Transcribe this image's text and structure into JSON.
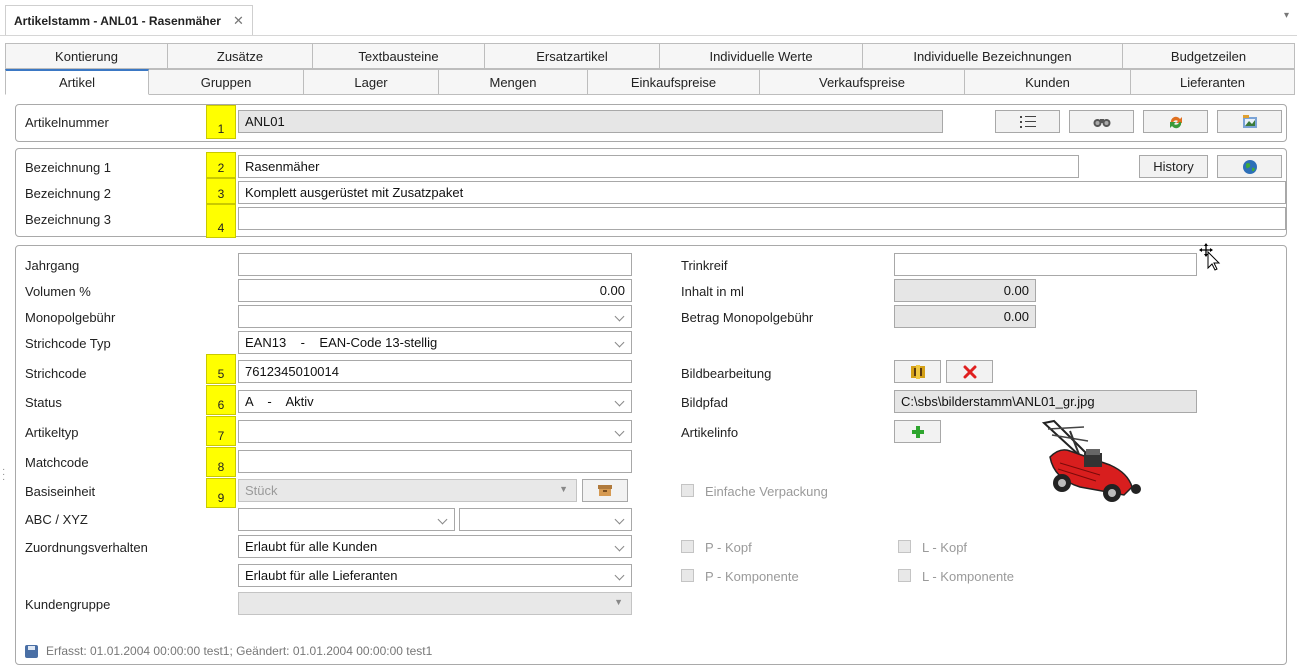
{
  "window": {
    "doc_tab_title": "Artikelstamm - ANL01 - Rasenmäher",
    "close_glyph": "✕",
    "dropdown_glyph": "▾"
  },
  "tabs_row1": [
    "Kontierung",
    "Zusätze",
    "Textbausteine",
    "Ersatzartikel",
    "Individuelle Werte",
    "Individuelle Bezeichnungen",
    "Budgetzeilen"
  ],
  "tabs_row2": [
    "Artikel",
    "Gruppen",
    "Lager",
    "Mengen",
    "Einkaufspreise",
    "Verkaufspreise",
    "Kunden",
    "Lieferanten"
  ],
  "active_tab": "Artikel",
  "article_number": {
    "label": "Artikelnummer",
    "badge": "1",
    "value": "ANL01",
    "buttons": [
      "list-icon",
      "binoculars-icon",
      "refresh-icon",
      "image-folder-icon"
    ]
  },
  "designations": {
    "history_label": "History",
    "rows": [
      {
        "label": "Bezeichnung 1",
        "badge": "2",
        "value": "Rasenmäher"
      },
      {
        "label": "Bezeichnung 2",
        "badge": "3",
        "value": "Komplett ausgerüstet mit Zusatzpaket"
      },
      {
        "label": "Bezeichnung 3",
        "badge": "4",
        "value": ""
      }
    ]
  },
  "left_fields": {
    "jahrgang": {
      "label": "Jahrgang",
      "value": ""
    },
    "volumen": {
      "label": "Volumen %",
      "value": "0.00"
    },
    "monopolgebuehr": {
      "label": "Monopolgebühr",
      "value": ""
    },
    "strichcode_typ": {
      "label": "Strichcode Typ",
      "value": "EAN13    -    EAN-Code 13-stellig"
    },
    "strichcode": {
      "label": "Strichcode",
      "badge": "5",
      "value": "7612345010014"
    },
    "status": {
      "label": "Status",
      "badge": "6",
      "value": "A    -    Aktiv"
    },
    "artikeltyp": {
      "label": "Artikeltyp",
      "badge": "7",
      "value": ""
    },
    "matchcode": {
      "label": "Matchcode",
      "badge": "8",
      "value": ""
    },
    "basiseinheit": {
      "label": "Basiseinheit",
      "badge": "9",
      "value": "Stück"
    },
    "abc_xyz": {
      "label": "ABC / XYZ",
      "value_abc": "",
      "value_xyz": ""
    },
    "zuordnung": {
      "label": "Zuordnungsverhalten",
      "value_kunden": "Erlaubt für alle Kunden",
      "value_lieferanten": "Erlaubt für alle Lieferanten"
    },
    "kundengruppe": {
      "label": "Kundengruppe",
      "value": ""
    }
  },
  "right_fields": {
    "trinkreif": {
      "label": "Trinkreif",
      "value": ""
    },
    "inhalt": {
      "label": "Inhalt in ml",
      "value": "0.00"
    },
    "betrag_monopol": {
      "label": "Betrag Monopolgebühr",
      "value": "0.00"
    },
    "bildbearbeitung": {
      "label": "Bildbearbeitung"
    },
    "bildpfad": {
      "label": "Bildpfad",
      "value": "C:\\sbs\\bilderstamm\\ANL01_gr.jpg"
    },
    "artikelinfo": {
      "label": "Artikelinfo"
    },
    "einfache_verpackung": {
      "label": "Einfache Verpackung",
      "checked": false
    },
    "p_kopf": {
      "label": "P - Kopf",
      "checked": false
    },
    "l_kopf": {
      "label": "L - Kopf",
      "checked": false
    },
    "p_komponente": {
      "label": "P - Komponente",
      "checked": false
    },
    "l_komponente": {
      "label": "L - Komponente",
      "checked": false
    }
  },
  "footer": {
    "text": "Erfasst: 01.01.2004 00:00:00 test1; Geändert: 01.01.2004 00:00:00 test1"
  },
  "colors": {
    "badge": "#ffff00",
    "active_tab_accent": "#3b78c4",
    "delete_red": "#e02020",
    "add_green": "#2ea52e",
    "mower_red": "#d81e1e"
  }
}
